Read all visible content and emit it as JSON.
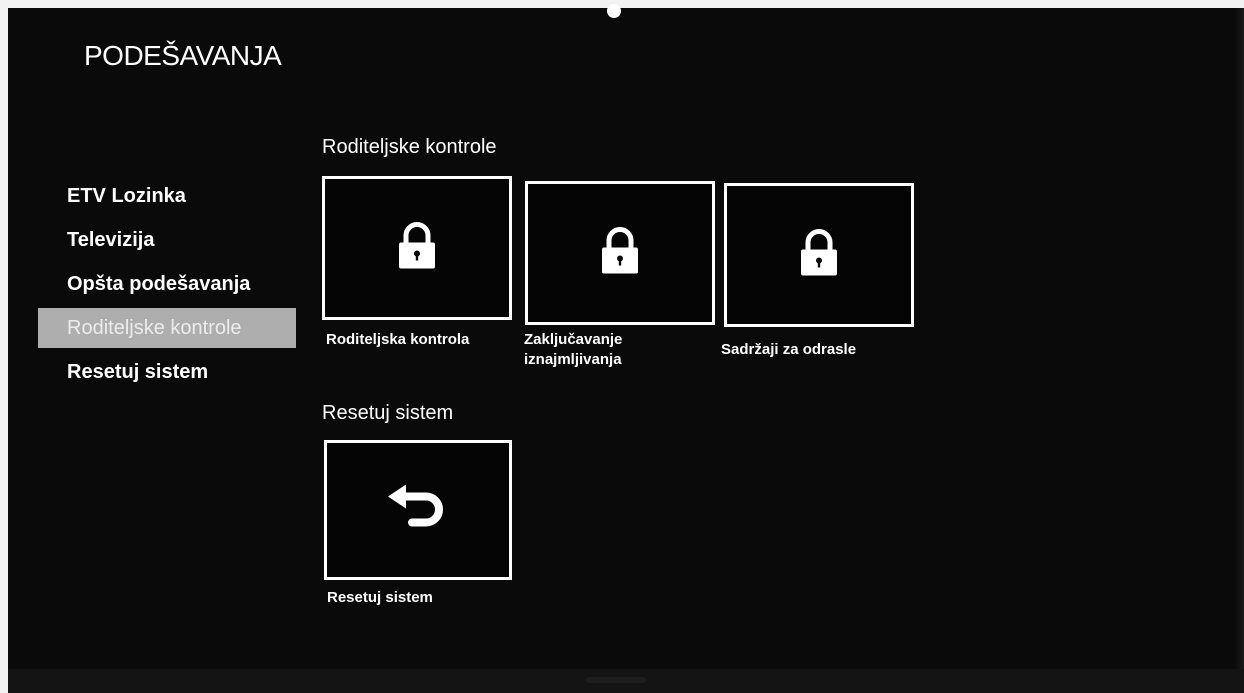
{
  "page": {
    "title": "PODEŠAVANJA"
  },
  "sidebar": {
    "items": [
      {
        "label": "ETV Lozinka",
        "active": false
      },
      {
        "label": "Televizija",
        "active": false
      },
      {
        "label": "Opšta podešavanja",
        "active": false
      },
      {
        "label": "Roditeljske kontrole",
        "active": true
      },
      {
        "label": "Resetuj sistem",
        "active": false
      }
    ]
  },
  "parental_section": {
    "title": "Roditeljske kontrole",
    "tiles": [
      {
        "label": "Roditeljska kontrola",
        "icon": "lock-icon"
      },
      {
        "label_line1": "Zaključavanje",
        "label_line2": "iznajmljivanja",
        "icon": "lock-icon"
      },
      {
        "label": "Sadržaji za odrasle",
        "icon": "lock-icon"
      }
    ]
  },
  "reset_section": {
    "title": "Resetuj sistem",
    "tiles": [
      {
        "label": "Resetuj sistem",
        "icon": "undo-arrow-icon"
      }
    ]
  },
  "colors": {
    "background": "#0a0a0a",
    "text": "#ffffff",
    "active_menu_bg": "#aeaeae"
  }
}
